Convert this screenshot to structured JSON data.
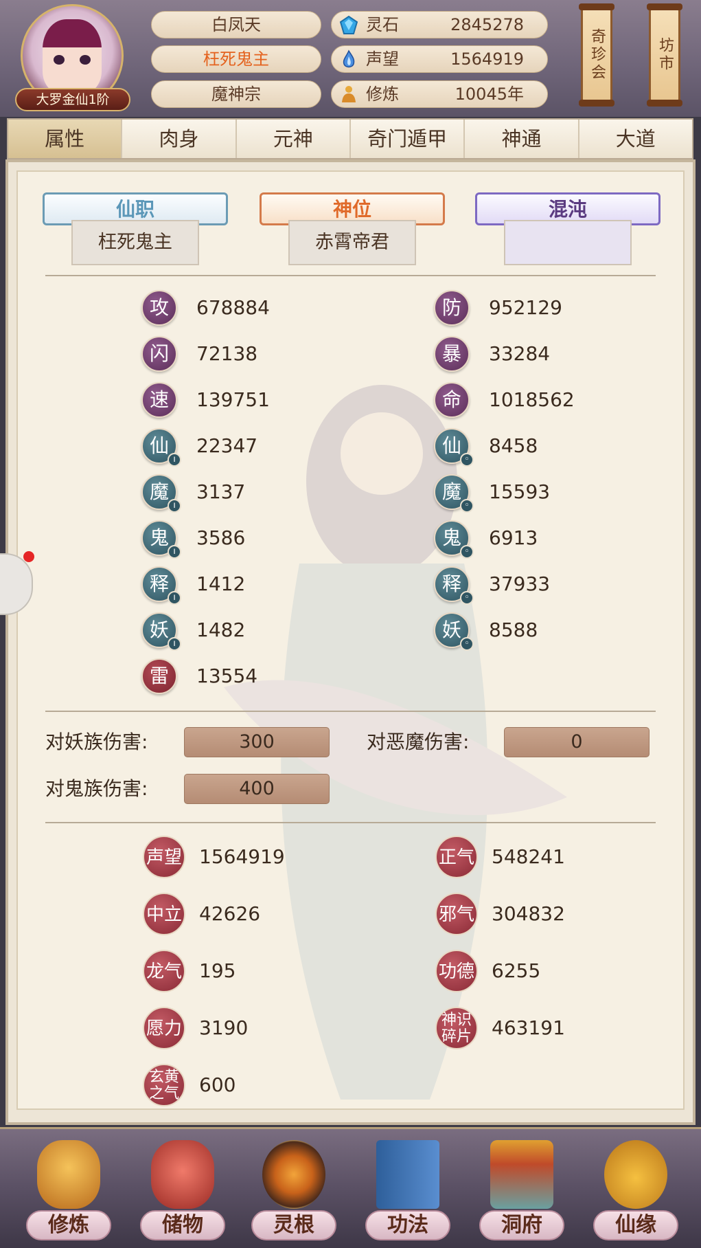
{
  "header": {
    "rank": "大罗金仙1阶",
    "name": "白凤天",
    "title": "枉死鬼主",
    "sect": "魔神宗",
    "stats": [
      {
        "icon": "crystal-icon",
        "label": "灵石",
        "value": "2845278"
      },
      {
        "icon": "flame-icon",
        "label": "声望",
        "value": "1564919"
      },
      {
        "icon": "meditate-icon",
        "label": "修炼",
        "value": "10045年"
      }
    ],
    "side_buttons": [
      "奇珍会",
      "坊市"
    ]
  },
  "tabs": [
    "属性",
    "肉身",
    "元神",
    "奇门遁甲",
    "神通",
    "大道"
  ],
  "plaques": [
    {
      "label": "仙职",
      "value": "枉死鬼主"
    },
    {
      "label": "神位",
      "value": "赤霄帝君"
    },
    {
      "label": "混沌",
      "value": ""
    }
  ],
  "stats_left": [
    {
      "badge": "攻",
      "value": "678884"
    },
    {
      "badge": "闪",
      "value": "72138"
    },
    {
      "badge": "速",
      "value": "139751"
    },
    {
      "badge": "仙",
      "value": "22347"
    },
    {
      "badge": "魔",
      "value": "3137"
    },
    {
      "badge": "鬼",
      "value": "3586"
    },
    {
      "badge": "释",
      "value": "1412"
    },
    {
      "badge": "妖",
      "value": "1482"
    },
    {
      "badge": "雷",
      "value": "13554"
    }
  ],
  "stats_right": [
    {
      "badge": "防",
      "value": "952129"
    },
    {
      "badge": "暴",
      "value": "33284"
    },
    {
      "badge": "命",
      "value": "1018562"
    },
    {
      "badge": "仙",
      "value": "8458"
    },
    {
      "badge": "魔",
      "value": "15593"
    },
    {
      "badge": "鬼",
      "value": "6913"
    },
    {
      "badge": "释",
      "value": "37933"
    },
    {
      "badge": "妖",
      "value": "8588"
    }
  ],
  "damage": [
    {
      "label": "对妖族伤害:",
      "value": "300"
    },
    {
      "label": "对恶魔伤害:",
      "value": "0"
    },
    {
      "label": "对鬼族伤害:",
      "value": "400"
    }
  ],
  "resources_left": [
    {
      "badge": "声望",
      "value": "1564919"
    },
    {
      "badge": "中立",
      "value": "42626"
    },
    {
      "badge": "龙气",
      "value": "195"
    },
    {
      "badge": "愿力",
      "value": "3190"
    },
    {
      "badge": "玄黄之气",
      "value": "600"
    }
  ],
  "resources_right": [
    {
      "badge": "正气",
      "value": "548241"
    },
    {
      "badge": "邪气",
      "value": "304832"
    },
    {
      "badge": "功德",
      "value": "6255"
    },
    {
      "badge": "神识碎片",
      "value": "463191"
    }
  ],
  "bottom_nav": [
    {
      "label": "修炼",
      "icon": "cultivate-icon"
    },
    {
      "label": "储物",
      "icon": "storage-bag-icon"
    },
    {
      "label": "灵根",
      "icon": "spirit-root-icon"
    },
    {
      "label": "功法",
      "icon": "scripture-book-icon"
    },
    {
      "label": "洞府",
      "icon": "cave-palace-icon"
    },
    {
      "label": "仙缘",
      "icon": "gourd-icon"
    }
  ]
}
